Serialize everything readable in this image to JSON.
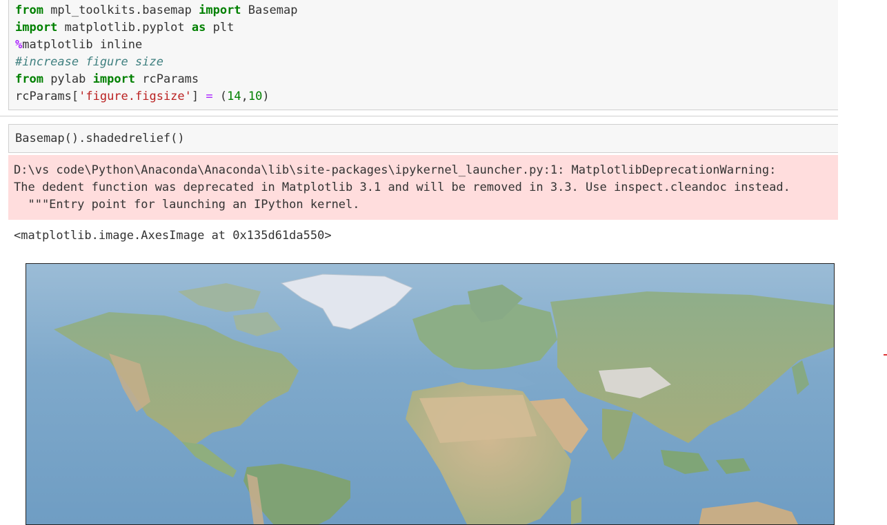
{
  "cell1": {
    "lines": [
      [
        "from",
        " mpl_toolkits.basemap ",
        "import",
        " Basemap"
      ],
      [
        "import",
        " matplotlib.pyplot ",
        "as",
        " plt"
      ],
      [
        "%",
        "matplotlib inline"
      ],
      [
        "#increase figure size"
      ],
      [
        "from",
        " pylab ",
        "import",
        " rcParams"
      ],
      [
        "rcParams[",
        "'figure.figsize'",
        "] ",
        "=",
        " (",
        "14",
        ",",
        "10",
        ")"
      ]
    ]
  },
  "cell2": {
    "code": "Basemap().shadedrelief()"
  },
  "stderr": {
    "line1": "D:\\vs code\\Python\\Anaconda\\Anaconda\\lib\\site-packages\\ipykernel_launcher.py:1: MatplotlibDeprecationWarning:",
    "line2": "The dedent function was deprecated in Matplotlib 3.1 and will be removed in 3.3. Use inspect.cleandoc instead.",
    "line3": "  \"\"\"Entry point for launching an IPython kernel."
  },
  "output": {
    "result": "<matplotlib.image.AxesImage at 0x135d61da550>"
  },
  "map": {
    "name": "shaded-relief-world-map",
    "ocean_color": "#7fa9cb",
    "land_color": "#9cae7f",
    "desert_color": "#c9b28e",
    "ice_color": "#e4e8ee"
  }
}
